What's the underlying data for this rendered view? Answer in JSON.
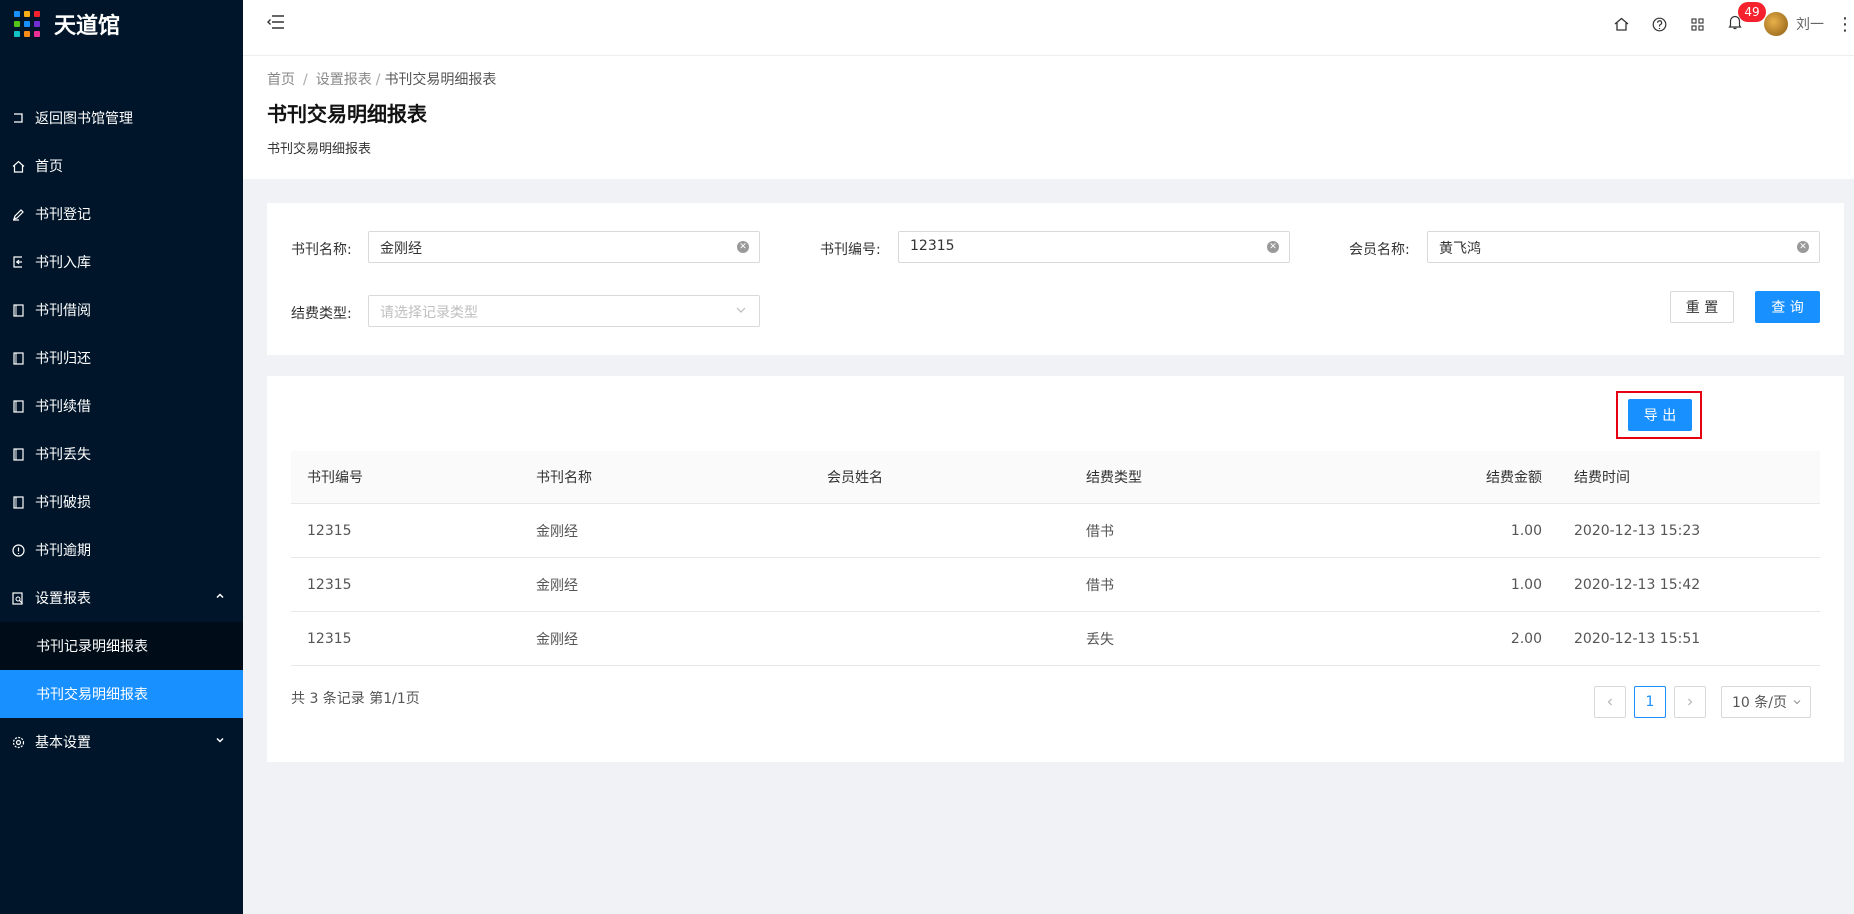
{
  "app": {
    "title": "天道馆",
    "logo_colors": [
      "#1890ff",
      "#faad14",
      "#f5222d",
      "#52c41a",
      "#1890ff",
      "#722ed1",
      "#13c2c2",
      "#fa8c16",
      "#eb2f96"
    ]
  },
  "sidebar": {
    "items": [
      {
        "label": "返回图书馆管理",
        "icon": "return-icon"
      },
      {
        "label": "首页",
        "icon": "home-icon"
      },
      {
        "label": "书刊登记",
        "icon": "pen-icon"
      },
      {
        "label": "书刊入库",
        "icon": "import-icon"
      },
      {
        "label": "书刊借阅",
        "icon": "book-icon"
      },
      {
        "label": "书刊归还",
        "icon": "book-icon"
      },
      {
        "label": "书刊续借",
        "icon": "book-icon"
      },
      {
        "label": "书刊丢失",
        "icon": "book-icon"
      },
      {
        "label": "书刊破损",
        "icon": "book-icon"
      },
      {
        "label": "书刊逾期",
        "icon": "exclamation-icon"
      },
      {
        "label": "设置报表",
        "icon": "report-icon",
        "expanded": true
      },
      {
        "label": "基本设置",
        "icon": "gear-icon"
      }
    ],
    "sub_items": [
      {
        "label": "书刊记录明细报表"
      },
      {
        "label": "书刊交易明细报表",
        "active": true
      }
    ]
  },
  "header": {
    "notifications": "49",
    "user_name": "刘一"
  },
  "breadcrumb": [
    "首页",
    "设置报表",
    "书刊交易明细报表"
  ],
  "page": {
    "title": "书刊交易明细报表",
    "description": "书刊交易明细报表"
  },
  "search": {
    "book_name_label": "书刊名称:",
    "book_name_value": "金刚经",
    "book_no_label": "书刊编号:",
    "book_no_value": "12315",
    "member_label": "会员名称:",
    "member_value": "黄飞鸿",
    "fee_type_label": "结费类型:",
    "fee_type_placeholder": "请选择记录类型",
    "reset_label": "重 置",
    "query_label": "查 询"
  },
  "table": {
    "export_label": "导 出",
    "columns": [
      "书刊编号",
      "书刊名称",
      "会员姓名",
      "结费类型",
      "结费金额",
      "结费时间"
    ],
    "rows": [
      [
        "12315",
        "金刚经",
        "",
        "借书",
        "1.00",
        "2020-12-13 15:23"
      ],
      [
        "12315",
        "金刚经",
        "",
        "借书",
        "1.00",
        "2020-12-13 15:42"
      ],
      [
        "12315",
        "金刚经",
        "",
        "丢失",
        "2.00",
        "2020-12-13 15:51"
      ]
    ],
    "total_text": "共 3 条记录 第1/1页",
    "current_page": "1",
    "page_size": "10 条/页"
  },
  "colors": {
    "sidebar_bg": "#001529",
    "primary": "#1890ff",
    "badge": "#f5222d",
    "highlight_box": "#e60012"
  }
}
